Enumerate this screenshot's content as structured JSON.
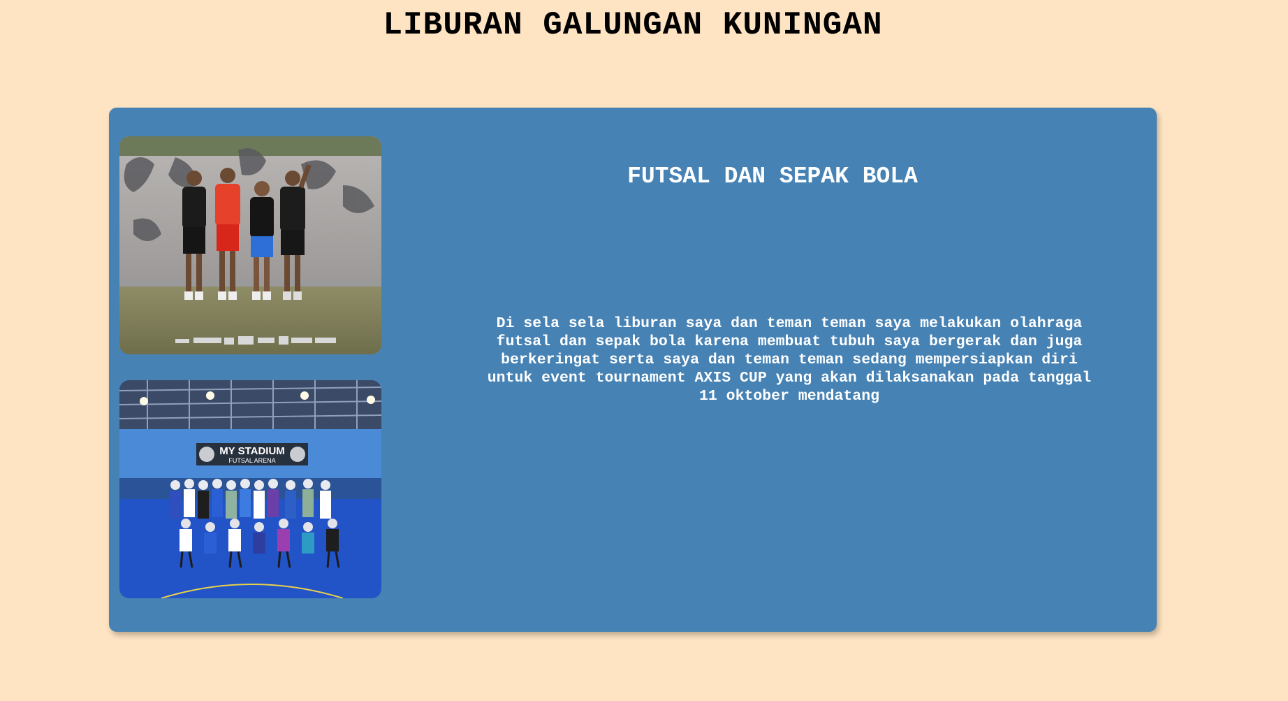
{
  "page": {
    "title": "LIBURAN GALUNGAN KUNINGAN"
  },
  "card": {
    "heading": "FUTSAL DAN SEPAK BOLA",
    "description": "Di sela sela liburan saya dan teman teman saya melakukan olahraga futsal dan sepak bola karena membuat tubuh saya bergerak dan juga berkeringat serta saya dan teman teman sedang mempersiapkan diri untuk event tournament AXIS CUP yang akan dilaksanakan pada tanggal 11 oktober mendatang",
    "photos": [
      {
        "kind": "outdoor-football-team-photo"
      },
      {
        "kind": "futsal-team-photo",
        "banner_title": "MY STADIUM",
        "banner_subtitle": "FUTSAL ARENA"
      }
    ]
  },
  "colors": {
    "background": "#fee4c3",
    "card": "#4682b4",
    "heading_text": "#ffffff",
    "title_text": "#000000"
  }
}
